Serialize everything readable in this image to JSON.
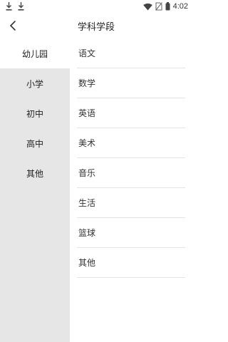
{
  "status_bar": {
    "time": "4:02",
    "left_icons": [
      "download-icon",
      "download-icon"
    ],
    "right_icons": [
      "wifi-icon",
      "no-sim-icon",
      "battery-icon"
    ]
  },
  "header": {
    "title": "学科学段",
    "back_icon": "chevron-left-icon"
  },
  "sidebar": {
    "active_index": 0,
    "items": [
      {
        "label": "幼儿园"
      },
      {
        "label": "小学"
      },
      {
        "label": "初中"
      },
      {
        "label": "高中"
      },
      {
        "label": "其他"
      }
    ]
  },
  "subjects": {
    "items": [
      {
        "label": "语文"
      },
      {
        "label": "数学"
      },
      {
        "label": "英语"
      },
      {
        "label": "美术"
      },
      {
        "label": "音乐"
      },
      {
        "label": "生活"
      },
      {
        "label": "篮球"
      },
      {
        "label": "其他"
      }
    ]
  },
  "colors": {
    "sidebar_bg": "#e6e6e6",
    "active_bg": "#ffffff",
    "divider": "#e3e3e3"
  }
}
